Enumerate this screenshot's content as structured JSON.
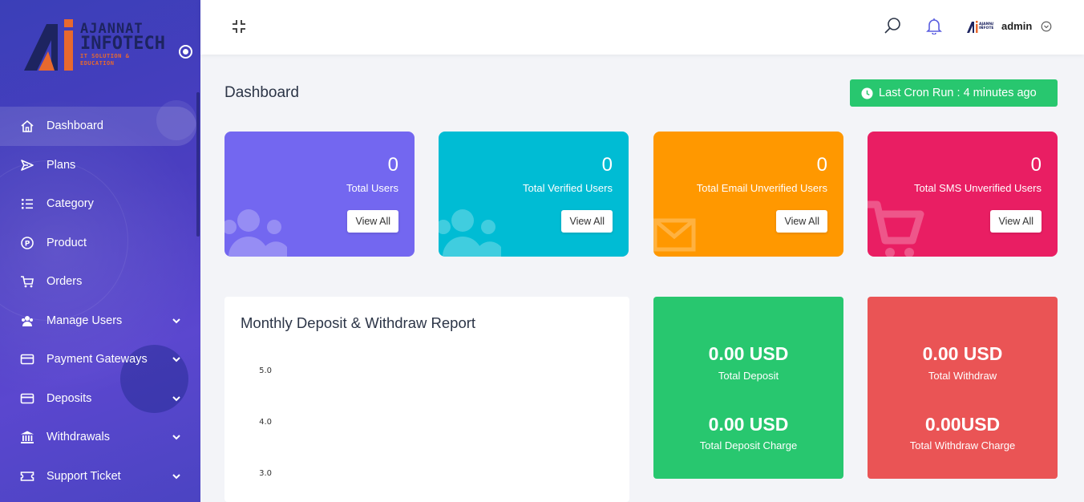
{
  "brand": {
    "line1": "AJANNAT",
    "line2": "INFOTECH",
    "tagline": "IT SOLUTION & EDUCATION"
  },
  "sidebar": {
    "items": [
      {
        "label": "Dashboard",
        "icon": "home-icon",
        "has_caret": false,
        "active": true
      },
      {
        "label": "Plans",
        "icon": "send-icon",
        "has_caret": false
      },
      {
        "label": "Category",
        "icon": "list-icon",
        "has_caret": false
      },
      {
        "label": "Product",
        "icon": "product-circle-icon",
        "has_caret": false
      },
      {
        "label": "Orders",
        "icon": "cart-icon",
        "has_caret": false
      },
      {
        "label": "Manage Users",
        "icon": "users-gear-icon",
        "has_caret": true
      },
      {
        "label": "Payment Gateways",
        "icon": "credit-card-icon",
        "has_caret": true
      },
      {
        "label": "Deposits",
        "icon": "credit-card-icon",
        "has_caret": true
      },
      {
        "label": "Withdrawals",
        "icon": "bank-icon",
        "has_caret": true
      },
      {
        "label": "Support Ticket",
        "icon": "ticket-icon",
        "has_caret": true
      }
    ]
  },
  "header": {
    "admin_name": "admin",
    "avatar_text": "AJANNAT INFOTECH"
  },
  "page": {
    "title": "Dashboard",
    "cron_label": "Last Cron Run : 4 minutes ago"
  },
  "stats": [
    {
      "value": "0",
      "label": "Total Users",
      "button": "View All",
      "color": "#7367f0",
      "icon": "users-icon"
    },
    {
      "value": "0",
      "label": "Total Verified Users",
      "button": "View All",
      "color": "#00bcd4",
      "icon": "users-icon"
    },
    {
      "value": "0",
      "label": "Total Email Unverified Users",
      "button": "View All",
      "color": "#ff9800",
      "icon": "envelope-icon"
    },
    {
      "value": "0",
      "label": "Total SMS Unverified Users",
      "button": "View All",
      "color": "#e91e63",
      "icon": "cart-icon"
    }
  ],
  "report": {
    "title": "Monthly Deposit & Withdraw Report"
  },
  "chart_data": {
    "type": "line",
    "title": "Monthly Deposit & Withdraw Report",
    "yticks": [
      "5.0",
      "4.0",
      "3.0"
    ],
    "ylim": [
      3,
      5
    ],
    "series": []
  },
  "money": {
    "deposit": {
      "value": "0.00 USD",
      "label": "Total Deposit",
      "charge_value": "0.00 USD",
      "charge_label": "Total Deposit Charge",
      "color": "#28c76f"
    },
    "withdraw": {
      "value": "0.00 USD",
      "label": "Total Withdraw",
      "charge_value": "0.00USD",
      "charge_label": "Total Withdraw Charge",
      "color": "#ea5455"
    }
  }
}
